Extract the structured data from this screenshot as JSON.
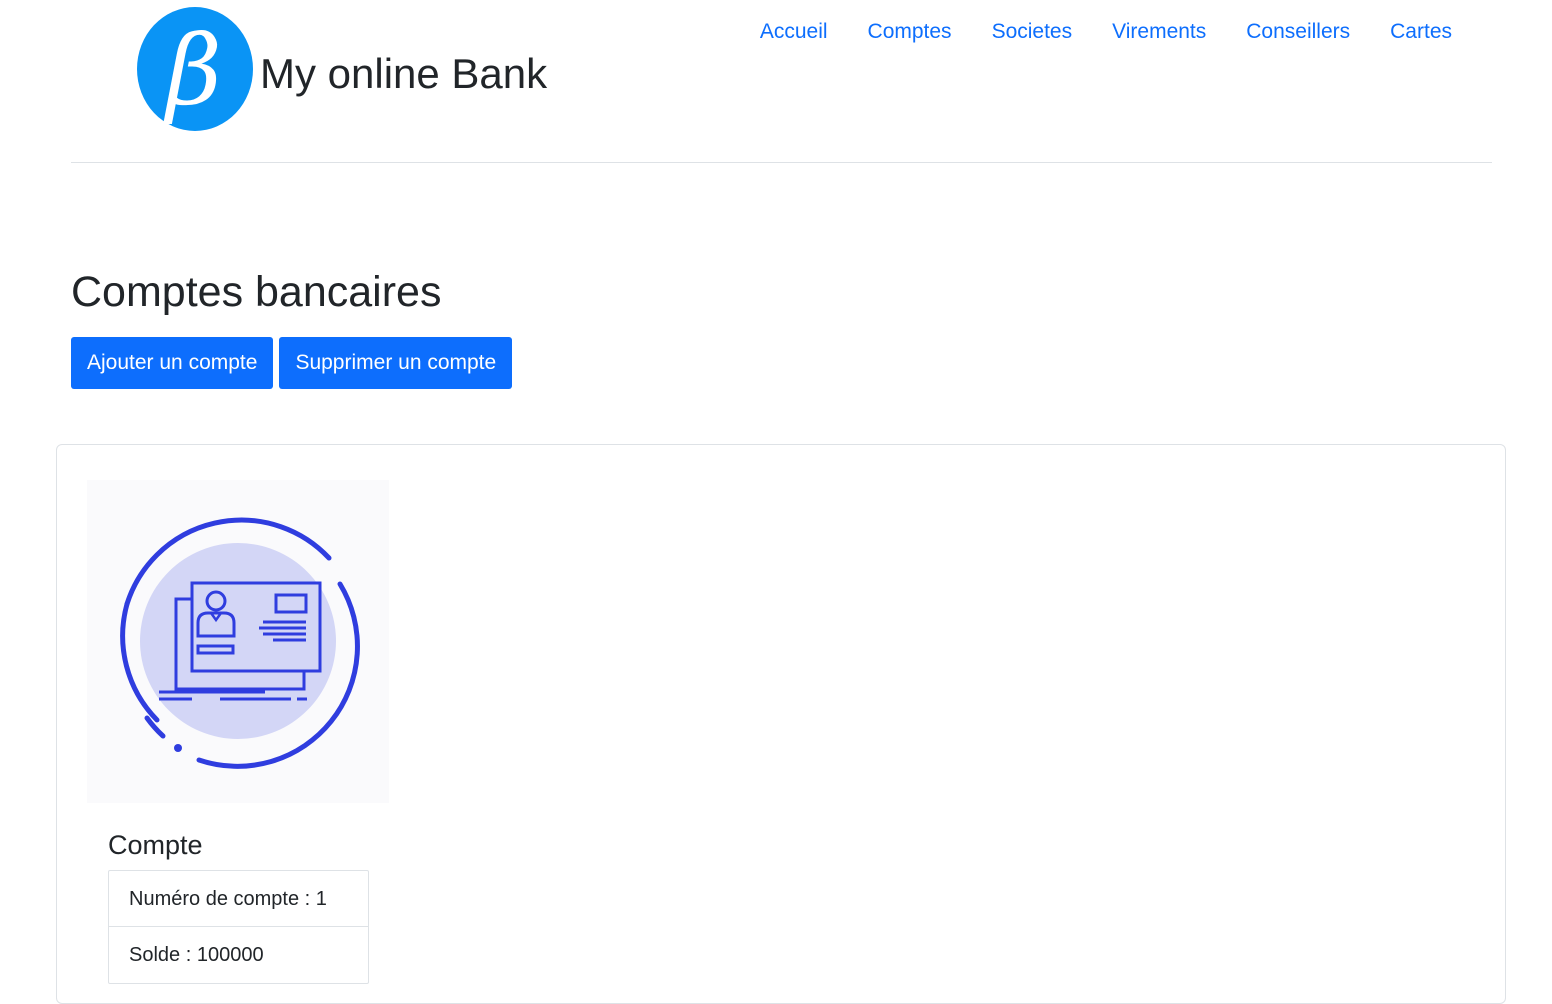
{
  "brand": {
    "logo_letter": "β",
    "name": "My online Bank"
  },
  "nav": {
    "items": [
      {
        "label": "Accueil"
      },
      {
        "label": "Comptes"
      },
      {
        "label": "Societes"
      },
      {
        "label": "Virements"
      },
      {
        "label": "Conseillers"
      },
      {
        "label": "Cartes"
      }
    ]
  },
  "main": {
    "title": "Comptes bancaires",
    "add_button_label": "Ajouter un compte",
    "delete_button_label": "Supprimer un compte"
  },
  "account_card": {
    "image_icon": "account-card-illustration",
    "title": "Compte",
    "details": [
      {
        "text": "Numéro de compte : 1"
      },
      {
        "text": "Solde : 100000"
      }
    ]
  },
  "colors": {
    "primary": "#0d6efd",
    "logo_blue": "#0a94f5",
    "illustration_blue": "#2f3ddf",
    "illustration_fill": "#d3d6f6"
  }
}
